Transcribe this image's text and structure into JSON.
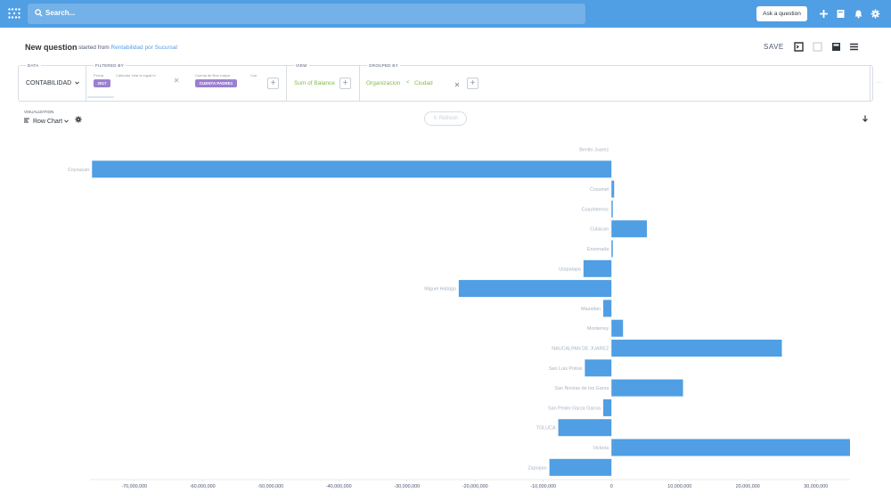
{
  "nav": {
    "search_placeholder": "Search...",
    "ask_label": "Ask a question"
  },
  "header": {
    "title": "New question",
    "started_prefix": "started from",
    "source": "Rentabilidad por Sucursal",
    "save_label": "SAVE"
  },
  "builder": {
    "data_label": "DATA",
    "data_value": "CONTABILIDAD",
    "filter_label": "FILTERED BY",
    "filter1_field": "Fecha",
    "filter1_op": "Calendar Year is equal to",
    "filter1_value": "2017",
    "filter2_field": "Cuenta de libro mayor",
    "filter2_field_b": "Cue",
    "filter2_value": "CUENTA PADRE1",
    "view_label": "VIEW",
    "view_value": "Sum of Balance",
    "group_label": "GROUPED BY",
    "group_value1": "Organizacion",
    "group_value2": "Ciudad"
  },
  "viz": {
    "label": "VISUALIZATION",
    "type": "Row Chart",
    "refresh_label": "Refresh"
  },
  "chart_data": {
    "type": "bar",
    "orientation": "horizontal",
    "categories": [
      "Benito Juarez",
      "Coyoacan",
      "Cozumel",
      "Cuauhtemoc",
      "Culiacan",
      "Ensenada",
      "Iztapalapa",
      "Miguel Hidalgo",
      "Mazatlan",
      "Monterrey",
      "NAUCALPAN DE JUAREZ",
      "San Luis Potosi",
      "San Nicolas de los Garza",
      "San Pedro Garza Garcia",
      "TOLUCA",
      "Victoria",
      "Zapopan"
    ],
    "values": [
      0,
      -76200000,
      400000,
      100000,
      5200000,
      200000,
      -4100000,
      -22400000,
      -1200000,
      1700000,
      25000000,
      -3900000,
      10500000,
      -1200000,
      -7800000,
      35000000,
      -9100000
    ],
    "xlim": [
      -76500000,
      35000000
    ],
    "ticks": [
      -70000000,
      -60000000,
      -50000000,
      -40000000,
      -30000000,
      -20000000,
      -10000000,
      0,
      10000000,
      20000000,
      30000000
    ],
    "tick_labels": [
      "-70,000,000",
      "-60,000,000",
      "-50,000,000",
      "-40,000,000",
      "-30,000,000",
      "-20,000,000",
      "-10,000,000",
      "0",
      "10,000,000",
      "20,000,000",
      "30,000,000"
    ],
    "color": "#509ee3"
  }
}
